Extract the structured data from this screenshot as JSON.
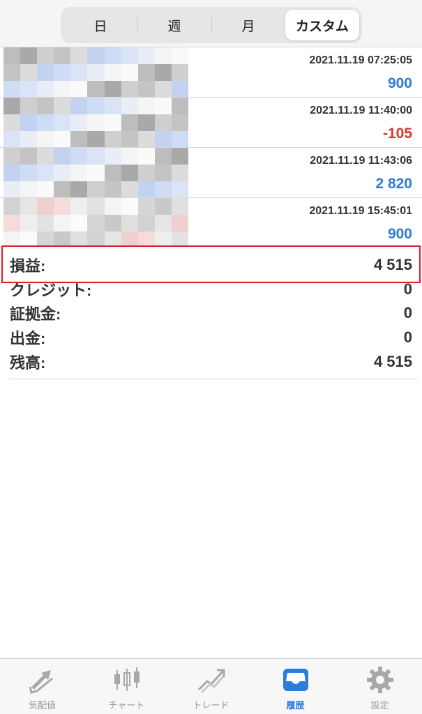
{
  "period_tabs": [
    {
      "label": "日",
      "active": false
    },
    {
      "label": "週",
      "active": false
    },
    {
      "label": "月",
      "active": false
    },
    {
      "label": "カスタム",
      "active": true
    }
  ],
  "deals": [
    {
      "time": "2021.11.19 07:25:05",
      "amount": "900",
      "sign": "positive"
    },
    {
      "time": "2021.11.19 11:40:00",
      "amount": "-105",
      "sign": "negative"
    },
    {
      "time": "2021.11.19 11:43:06",
      "amount": "2 820",
      "sign": "positive"
    },
    {
      "time": "2021.11.19 15:45:01",
      "amount": "900",
      "sign": "positive"
    }
  ],
  "summary": {
    "profit_label": "損益:",
    "profit_value": "4 515",
    "credit_label": "クレジット:",
    "credit_value": "0",
    "deposit_label": "証拠金:",
    "deposit_value": "0",
    "withdrawal_label": "出金:",
    "withdrawal_value": "0",
    "balance_label": "残高:",
    "balance_value": "4 515"
  },
  "tabbar": [
    {
      "label": "気配値",
      "icon": "quotes-arrows-icon",
      "active": false
    },
    {
      "label": "チャート",
      "icon": "candlestick-icon",
      "active": false
    },
    {
      "label": "トレード",
      "icon": "trade-trend-icon",
      "active": false
    },
    {
      "label": "履歴",
      "icon": "inbox-tray-icon",
      "active": true
    },
    {
      "label": "設定",
      "icon": "gear-icon",
      "active": false
    }
  ],
  "colors": {
    "accent": "#2f7bdb",
    "negative": "#d23a2f",
    "highlight_border": "#e0182b"
  }
}
